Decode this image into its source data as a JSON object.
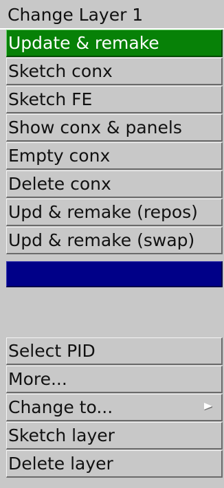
{
  "menu": {
    "title": "Change Layer 1",
    "items": [
      {
        "label": "Update & remake",
        "active": true
      },
      {
        "label": "Sketch conx"
      },
      {
        "label": "Sketch FE"
      },
      {
        "label": "Show conx & panels"
      },
      {
        "label": "Empty conx"
      },
      {
        "label": "Delete conx"
      },
      {
        "label": "Upd & remake (repos)"
      },
      {
        "label": "Upd & remake (swap)"
      }
    ],
    "lower_items": [
      {
        "label": "Select PID"
      },
      {
        "label": "More..."
      },
      {
        "label": "Change to...",
        "has_submenu": true,
        "submenu_icon": "submenu-arrow-icon"
      },
      {
        "label": "Sketch layer"
      },
      {
        "label": "Delete layer"
      }
    ]
  },
  "colors": {
    "panel": "#c8c8c8",
    "active": "#078107",
    "blank_bar": "#000088"
  }
}
